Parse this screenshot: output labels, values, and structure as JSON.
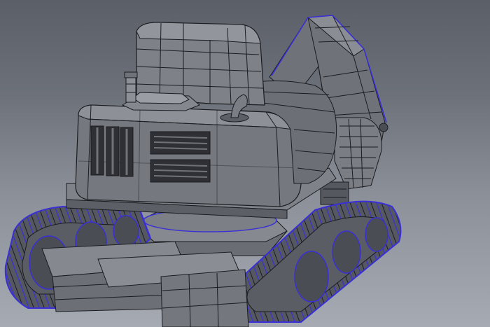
{
  "scene": {
    "subject": "excavator-wireframe-model",
    "view": "perspective",
    "display_mode": "wireframe-on-shaded"
  },
  "colors": {
    "background_top": "#5b5f68",
    "background_bottom": "#a6abb3",
    "surface_light": "#8a8d93",
    "surface_mid": "#6f7278",
    "surface_dark": "#4a4d53",
    "wire": "#1a1c20",
    "selected_wire": "#3a2fd6"
  },
  "selection": {
    "selected_parts": [
      "left-track",
      "right-track",
      "boom-arm-edges"
    ]
  }
}
